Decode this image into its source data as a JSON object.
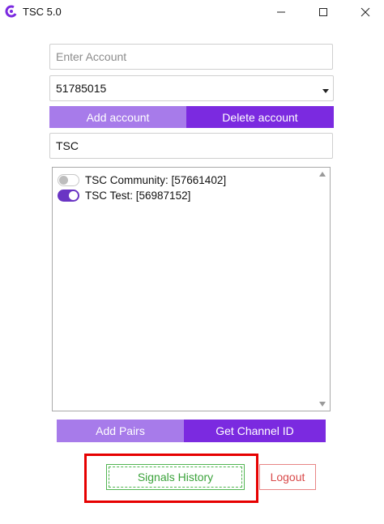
{
  "window": {
    "title": "TSC 5.0",
    "logo_icon": "c-logo-icon",
    "controls": [
      "minimize-icon",
      "maximize-icon",
      "close-icon"
    ]
  },
  "account_form": {
    "account_input_value": "",
    "account_input_placeholder": "Enter Account",
    "selected_account": "51785015",
    "add_account_label": "Add account",
    "delete_account_label": "Delete account"
  },
  "filter": {
    "value": "TSC"
  },
  "channels": [
    {
      "label": "TSC Community: [57661402]",
      "enabled": false
    },
    {
      "label": "TSC Test: [56987152]",
      "enabled": true
    }
  ],
  "actions": {
    "add_pairs_label": "Add Pairs",
    "get_channel_id_label": "Get Channel ID",
    "signals_history_label": "Signals History",
    "logout_label": "Logout"
  },
  "colors": {
    "accent_light": "#a77bea",
    "accent_dark": "#7b2ae0",
    "toggle_on": "#6a35c4",
    "signals_green": "#3aa23a",
    "logout_red": "#d94a4a",
    "highlight_red": "#e60000"
  }
}
